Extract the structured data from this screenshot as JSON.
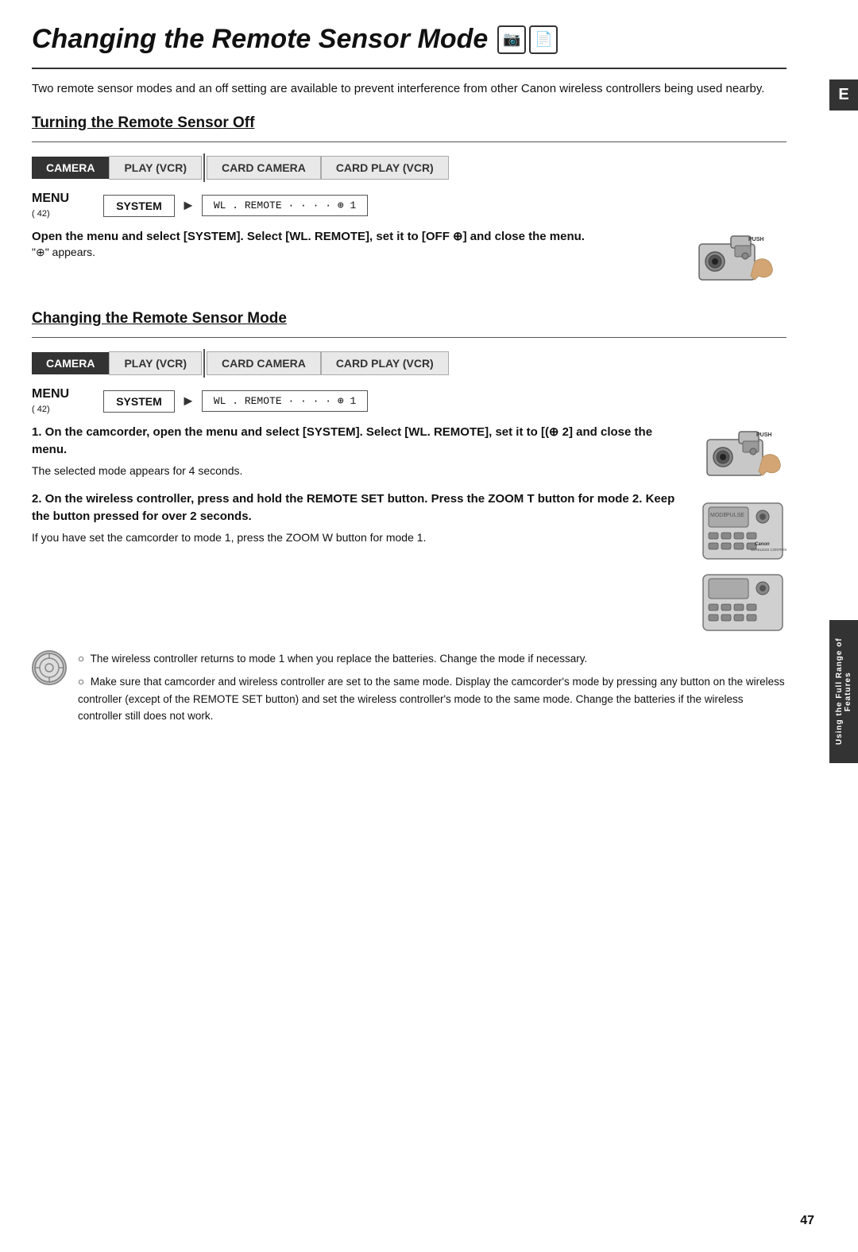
{
  "page": {
    "title": "Changing the Remote Sensor Mode",
    "intro": "Two remote sensor modes and an off setting are available to prevent interference from other Canon wireless controllers being used nearby.",
    "section1": {
      "heading": "Turning the Remote Sensor Off",
      "tabs": [
        {
          "label": "CAMERA",
          "style": "dark"
        },
        {
          "label": "PLAY (VCR)",
          "style": "light"
        },
        {
          "label": "CARD CAMERA",
          "style": "light"
        },
        {
          "label": "CARD PLAY (VCR)",
          "style": "light"
        }
      ],
      "menu_label": "MENU",
      "menu_sub": "(  42)",
      "system_label": "SYSTEM",
      "wl_text": "WL . REMOTE · · · · ⊕ 1",
      "instruction": "Open the menu and select [SYSTEM]. Select [WL. REMOTE], set it to [OFF ⊕] and close the menu.",
      "appears": "\"⊕\" appears."
    },
    "section2": {
      "heading": "Changing the Remote Sensor Mode",
      "tabs": [
        {
          "label": "CAMERA",
          "style": "dark"
        },
        {
          "label": "PLAY (VCR)",
          "style": "light"
        },
        {
          "label": "CARD CAMERA",
          "style": "light"
        },
        {
          "label": "CARD PLAY (VCR)",
          "style": "light"
        }
      ],
      "menu_label": "MENU",
      "menu_sub": "(  42)",
      "system_label": "SYSTEM",
      "wl_text": "WL . REMOTE · · · · ⊕ 1",
      "step1_bold": "1. On the camcorder, open the menu and select [SYSTEM]. Select [WL. REMOTE], set it to [(⊕ 2] and close the menu.",
      "step1_normal": "The selected mode appears for 4 seconds.",
      "step2_bold": "2. On the wireless controller, press and hold the REMOTE SET button. Press the ZOOM T button for mode 2. Keep the button pressed for over 2 seconds.",
      "step2_normal": "If you have set the camcorder to mode 1, press the ZOOM W button for mode 1."
    },
    "notes": [
      "The wireless controller returns to mode 1 when you replace the batteries. Change the mode if necessary.",
      "Make sure that camcorder and wireless controller are set to the same mode. Display the camcorder's mode by pressing any button on the wireless controller (except of the REMOTE SET button) and set the wireless controller's mode to the same mode. Change the batteries if the wireless controller still does not work."
    ],
    "right_tab_e": "E",
    "right_side_label": "Using the Full Range of Features",
    "page_number": "47"
  }
}
